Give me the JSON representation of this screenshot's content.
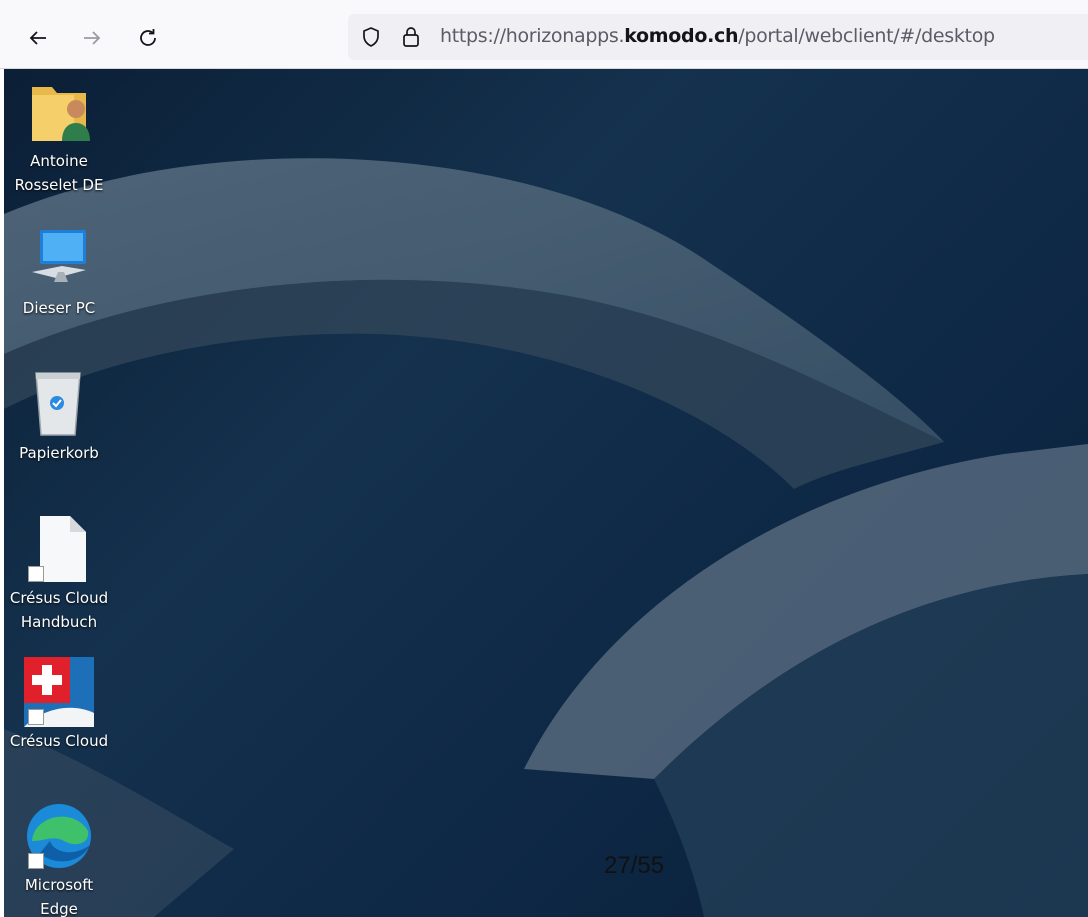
{
  "browser": {
    "url_prefix": "https://horizonapps.",
    "url_domain": "komodo.ch",
    "url_path": "/portal/webclient/#/desktop"
  },
  "desktop_icons": [
    {
      "label_line1": "Antoine",
      "label_line2": "Rosselet  DE",
      "icon": "user-folder-icon"
    },
    {
      "label_line1": "Dieser PC",
      "icon": "computer-icon"
    },
    {
      "label_line1": "Papierkorb",
      "icon": "recycle-bin-icon"
    },
    {
      "label_line1": "Crésus Cloud",
      "label_line2": "Handbuch",
      "icon": "document-icon"
    },
    {
      "label_line1": "Crésus Cloud",
      "icon": "cresus-app-icon"
    },
    {
      "label_line1": "Microsoft",
      "label_line2": "Edge",
      "icon": "edge-icon"
    }
  ],
  "page_indicator": "27/55",
  "colors": {
    "desktop_bg": "#0d2744",
    "swirl": "#4a6278",
    "accent_red": "#e0202a"
  }
}
